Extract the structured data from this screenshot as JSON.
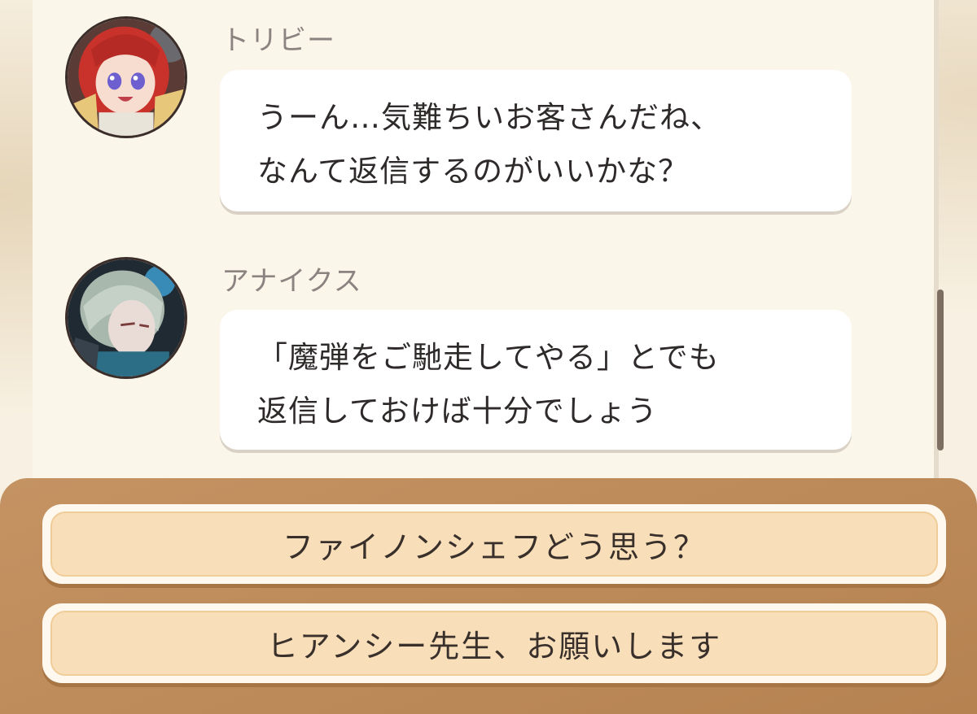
{
  "messages": [
    {
      "speaker": "トリビー",
      "avatar_icon": "character-portrait-red-hair",
      "lines": [
        "うーん…気難ちいお客さんだね、",
        "なんて返信するのがいいかな？"
      ]
    },
    {
      "speaker": "アナイクス",
      "avatar_icon": "character-portrait-silver-hair",
      "lines": [
        "「魔弾をご馳走してやる」とでも",
        "返信しておけば十分でしょう"
      ]
    }
  ],
  "options": [
    {
      "label": "ファイノンシェフどう思う？"
    },
    {
      "label": "ヒアンシー先生、お願いします"
    }
  ],
  "colors": {
    "background": "#f8f1e3",
    "bubble": "#ffffff",
    "option_panel": "#c08a55",
    "option_fill": "#f8dfba"
  }
}
